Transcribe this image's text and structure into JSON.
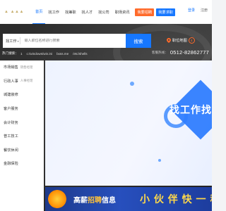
{
  "nav": {
    "links": [
      "首页",
      "找工作",
      "找兼职",
      "找人才",
      "找公司",
      "职场资讯"
    ],
    "recruit_button": "我要招聘",
    "job_button": "我要求职",
    "login": "登录",
    "register": "注册"
  },
  "search": {
    "type_label": "找工作",
    "placeholder": "输入职位名称进行搜索",
    "button": "搜索",
    "map_search": "职位地图",
    "map_badge": "4"
  },
  "hot": {
    "label": "热门搜索：",
    "items": [
      "1",
      "c:/windows/win.ini",
      "bxss.me",
      "/etc/shells"
    ],
    "hotline_label": "客服热线：",
    "hotline_number": "0512-82862777"
  },
  "categories": [
    {
      "name": "市场销售",
      "sub": "销售经理"
    },
    {
      "name": "行政人事",
      "sub": "人事经理"
    },
    {
      "name": "城建装修",
      "sub": ""
    },
    {
      "name": "客户服务",
      "sub": ""
    },
    {
      "name": "会计财务",
      "sub": ""
    },
    {
      "name": "普工技工",
      "sub": ""
    },
    {
      "name": "餐饮休闲",
      "sub": ""
    },
    {
      "name": "金融保险",
      "sub": ""
    }
  ],
  "banner": {
    "title": "找工作找"
  },
  "promo": {
    "prefix": "高薪",
    "highlight": "招聘",
    "suffix": "信息",
    "slogan": "小 伙 伴 快 一 秒 !"
  },
  "colors": {
    "brand_blue": "#1677ff",
    "accent_orange": "#ff6a2a",
    "promo_yellow": "#ffd84a"
  }
}
